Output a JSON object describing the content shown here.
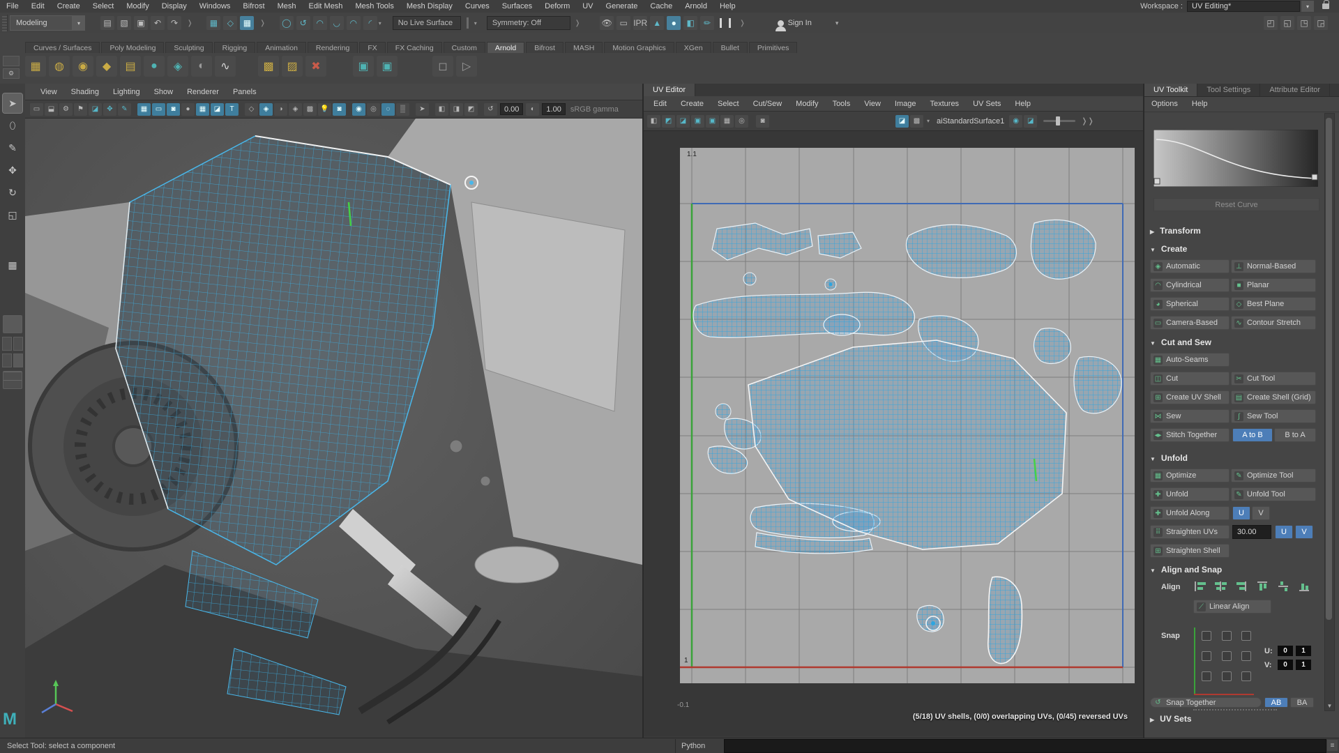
{
  "menubar": {
    "items": [
      "File",
      "Edit",
      "Create",
      "Select",
      "Modify",
      "Display",
      "Windows",
      "Bifrost",
      "Mesh",
      "Edit Mesh",
      "Mesh Tools",
      "Mesh Display",
      "Curves",
      "Surfaces",
      "Deform",
      "UV",
      "Generate",
      "Cache",
      "Arnold",
      "Help"
    ]
  },
  "app": {
    "workspace_label": "Workspace :",
    "workspace_value": "UV Editing*"
  },
  "toolbar": {
    "mode": "Modeling",
    "live_surface": "No Live Surface",
    "symmetry": "Symmetry: Off",
    "sign_in": "Sign In"
  },
  "shelf": {
    "tabs": [
      "Curves / Surfaces",
      "Poly Modeling",
      "Sculpting",
      "Rigging",
      "Animation",
      "Rendering",
      "FX",
      "FX Caching",
      "Custom",
      "Arnold",
      "Bifrost",
      "MASH",
      "Motion Graphics",
      "XGen",
      "Bullet",
      "Primitives"
    ],
    "active_tab": "Arnold"
  },
  "viewport": {
    "menus": [
      "View",
      "Shading",
      "Lighting",
      "Show",
      "Renderer",
      "Panels"
    ],
    "exposure": "0.00",
    "gamma": "1.00",
    "gamma_label": "sRGB gamma"
  },
  "uv_editor": {
    "tab": "UV Editor",
    "menus": [
      "Edit",
      "Create",
      "Select",
      "Cut/Sew",
      "Modify",
      "Tools",
      "View",
      "Image",
      "Textures",
      "UV Sets",
      "Help"
    ],
    "material": "aiStandardSurface1",
    "status": "(5/18) UV shells, (0/0) overlapping UVs, (0/45) reversed UVs",
    "axis_top": "1.1",
    "axis_one": "1",
    "axis_bottom": "-0.1"
  },
  "toolkit": {
    "tabs": [
      "UV Toolkit",
      "Tool Settings",
      "Attribute Editor"
    ],
    "menus": [
      "Options",
      "Help"
    ],
    "reset_curve": "Reset Curve",
    "transform": {
      "title": "Transform"
    },
    "create": {
      "title": "Create",
      "buttons": [
        "Automatic",
        "Normal-Based",
        "Cylindrical",
        "Planar",
        "Spherical",
        "Best Plane",
        "Camera-Based",
        "Contour Stretch"
      ]
    },
    "cut_sew": {
      "title": "Cut and Sew",
      "auto_seams": "Auto-Seams",
      "cut": "Cut",
      "cut_tool": "Cut Tool",
      "create_uv_shell": "Create UV Shell",
      "create_shell_grid": "Create Shell (Grid)",
      "sew": "Sew",
      "sew_tool": "Sew Tool",
      "stitch_together": "Stitch Together",
      "a_to_b": "A to B",
      "b_to_a": "B to A"
    },
    "unfold": {
      "title": "Unfold",
      "optimize": "Optimize",
      "optimize_tool": "Optimize Tool",
      "unfold": "Unfold",
      "unfold_tool": "Unfold Tool",
      "unfold_along": "Unfold Along",
      "u": "U",
      "v": "V",
      "straighten_uvs": "Straighten UVs",
      "angle": "30.00",
      "straighten_shell": "Straighten Shell"
    },
    "align_snap": {
      "title": "Align and Snap",
      "align_label": "Align",
      "linear_align": "Linear Align",
      "snap_label": "Snap",
      "u_label": "U:",
      "v_label": "V:",
      "u0": "0",
      "u1": "1",
      "v0": "0",
      "v1": "1",
      "snap_together": "Snap Together",
      "ab": "AB",
      "ba": "BA"
    },
    "uv_sets": {
      "title": "UV Sets"
    }
  },
  "statusbar": {
    "help": "Select Tool: select a component",
    "command_label": "Python"
  },
  "colors": {
    "accent_blue": "#4d7eb8",
    "uv_cyan": "#2da5e0",
    "icon_green": "#64c08d",
    "highlight_teal": "#3f7e9d"
  }
}
